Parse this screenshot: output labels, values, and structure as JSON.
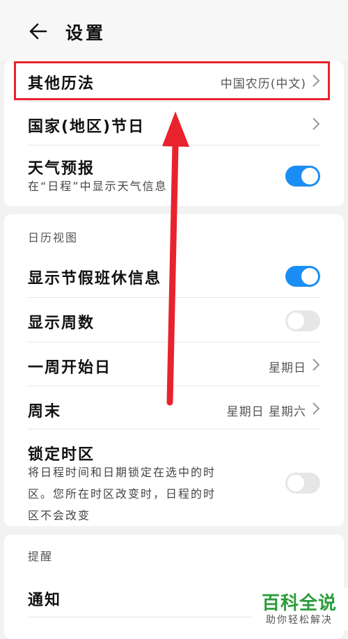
{
  "header": {
    "title": "设置"
  },
  "card1": {
    "other_calendar": {
      "label": "其他历法",
      "value": "中国农历(中文)"
    },
    "holidays": {
      "label": "国家(地区)节日"
    },
    "weather": {
      "label": "天气预报",
      "sub": "在“日程”中显示天气信息",
      "on": true
    }
  },
  "calendar_view": {
    "section_title": "日历视图",
    "show_holiday_work": {
      "label": "显示节假班休信息",
      "on": true
    },
    "show_week_numbers": {
      "label": "显示周数",
      "on": false
    },
    "week_start": {
      "label": "一周开始日",
      "value": "星期日"
    },
    "weekend": {
      "label": "周末",
      "value": "星期日 星期六"
    },
    "lock_timezone": {
      "label": "锁定时区",
      "sub_lines": [
        "将日程时间和日期锁定在选中的时",
        "区。您所在时区改变时，日程的时",
        "区不会改变"
      ],
      "on": false
    }
  },
  "reminders": {
    "section_title": "提醒",
    "notifications": {
      "label": "通知"
    }
  },
  "watermark": {
    "title": "百科全说",
    "subtitle": "助你轻松解决"
  },
  "colors": {
    "accent": "#1b8ef5",
    "annotation_red": "#e8232d",
    "watermark_green": "#2a9d3a"
  }
}
